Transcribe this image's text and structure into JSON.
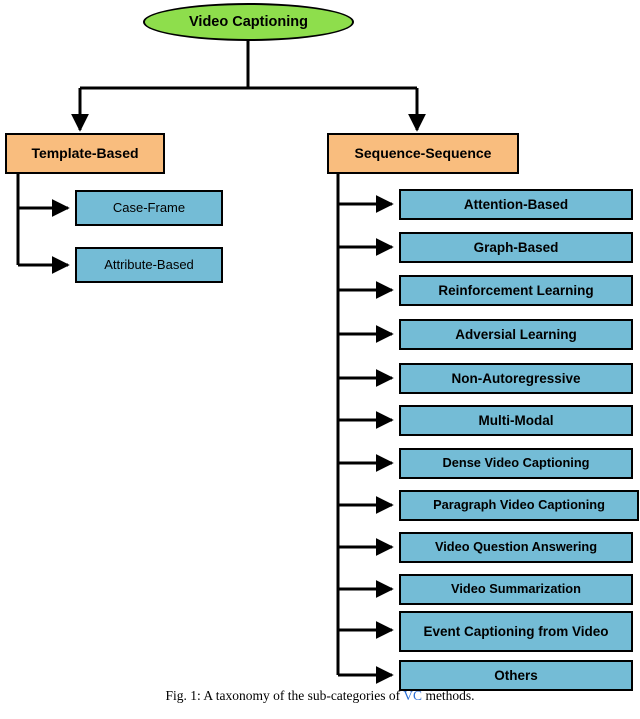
{
  "figure": {
    "root": {
      "label": "Video Captioning",
      "color": "#8ede4c"
    },
    "categories": [
      {
        "label": "Template-Based",
        "color": "#f9bd7e"
      },
      {
        "label": "Sequence-Sequence",
        "color": "#f9bd7e"
      }
    ],
    "template_children": [
      {
        "label": "Case-Frame",
        "color": "#74bcd6"
      },
      {
        "label": "Attribute-Based",
        "color": "#74bcd6"
      }
    ],
    "sequence_children": [
      {
        "label": "Attention-Based",
        "color": "#74bcd6"
      },
      {
        "label": "Graph-Based",
        "color": "#74bcd6"
      },
      {
        "label": "Reinforcement Learning",
        "color": "#74bcd6"
      },
      {
        "label": "Adversial Learning",
        "color": "#74bcd6"
      },
      {
        "label": "Non-Autoregressive",
        "color": "#74bcd6"
      },
      {
        "label": "Multi-Modal",
        "color": "#74bcd6"
      },
      {
        "label": "Dense Video Captioning",
        "color": "#74bcd6"
      },
      {
        "label": "Paragraph Video Captioning",
        "color": "#74bcd6"
      },
      {
        "label": "Video Question Answering",
        "color": "#74bcd6"
      },
      {
        "label": "Video Summarization",
        "color": "#74bcd6"
      },
      {
        "label": "Event Captioning from Video",
        "color": "#74bcd6"
      },
      {
        "label": "Others",
        "color": "#74bcd6"
      }
    ],
    "caption": {
      "prefix": "Fig. 1: A taxonomy of the sub-categories of ",
      "link": "VC",
      "suffix": " methods."
    }
  }
}
